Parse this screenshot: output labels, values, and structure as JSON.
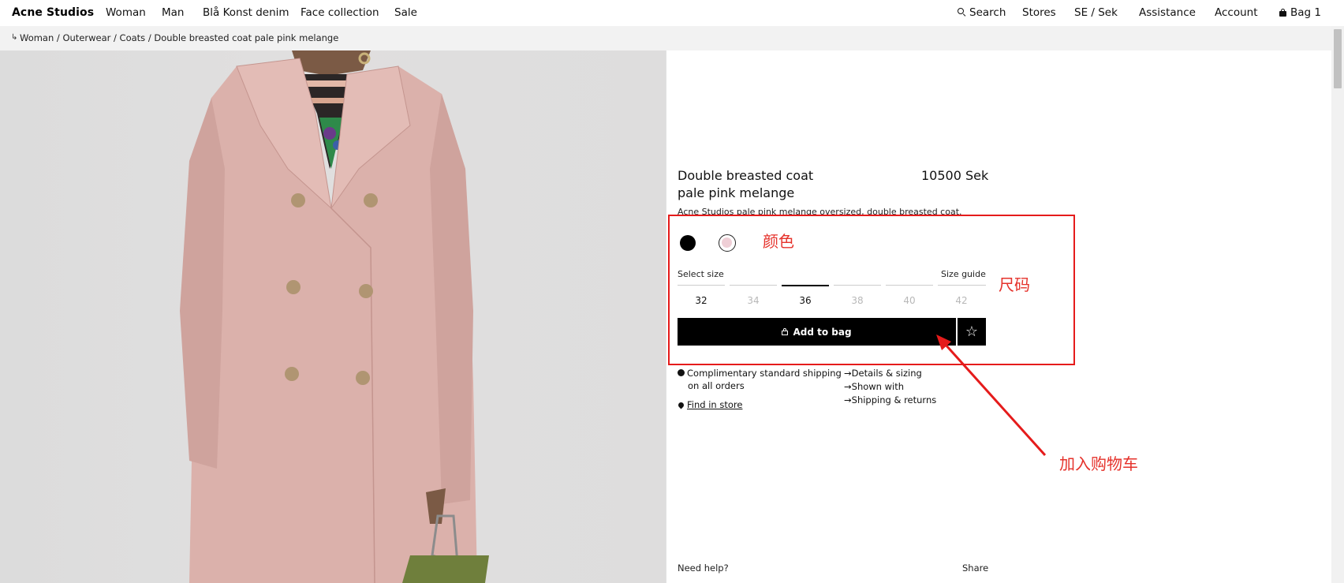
{
  "nav": {
    "logo": "Acne Studios",
    "left_links": [
      "Woman",
      "Man",
      "Blå Konst denim",
      "Face collection",
      "Sale"
    ],
    "search": "Search",
    "stores": "Stores",
    "region": "SE / Sek",
    "assistance": "Assistance",
    "account": "Account",
    "bag": "Bag 1"
  },
  "breadcrumb": {
    "arrow": "↳",
    "path": "Woman / Outerwear / Coats / Double breasted coat pale pink melange"
  },
  "product": {
    "title_line1": "Double breasted coat",
    "title_line2": "pale pink melange",
    "price": "10500 Sek",
    "description": "Acne Studios pale pink melange oversized, double breasted coat.",
    "colors": [
      {
        "name": "black",
        "hex": "#000000"
      },
      {
        "name": "pale pink melange",
        "hex": "#efcfd6"
      }
    ],
    "select_size_label": "Select size",
    "size_guide_label": "Size guide",
    "sizes": [
      {
        "label": "32",
        "available": true
      },
      {
        "label": "34",
        "available": false
      },
      {
        "label": "36",
        "available": true
      },
      {
        "label": "38",
        "available": false
      },
      {
        "label": "40",
        "available": false
      },
      {
        "label": "42",
        "available": false
      }
    ],
    "add_to_bag": "Add to bag",
    "wishlist_glyph": "☆",
    "shipping_line1": "Complimentary standard shipping",
    "shipping_line2": "on all orders",
    "find_in_store": "Find in store",
    "links": [
      "Details & sizing",
      "Shown with",
      "Shipping & returns"
    ],
    "link_arrow": "→"
  },
  "footer": {
    "need_help": "Need help?",
    "share": "Share"
  },
  "annotations": {
    "color": "颜色",
    "size": "尺码",
    "add_to_cart": "加入购物车",
    "annotation_color": "#e51b1b"
  },
  "colors": {
    "accent": "#000000",
    "breadcrumb_bg": "#f2f2f2",
    "coat_pink": "#dbb1ab"
  }
}
